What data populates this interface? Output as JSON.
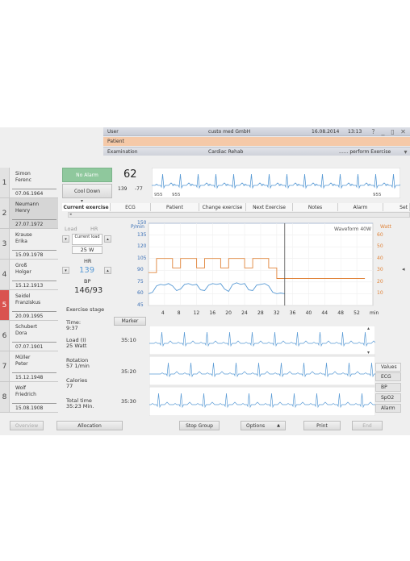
{
  "header": {
    "user_label": "User",
    "user_value": "custo med GmbH",
    "date": "16.08.2014",
    "time": "13:13",
    "patient_label": "Patient",
    "examination_label": "Examination",
    "examination_value": "Cardiac Rehab",
    "perform_label": "...... perform Exercise"
  },
  "patients": [
    {
      "num": "1",
      "first": "Simon",
      "last": "Ferenc",
      "dob": "07.06.1964"
    },
    {
      "num": "2",
      "first": "Neumann",
      "last": "Henry",
      "dob": "27.07.1972"
    },
    {
      "num": "3",
      "first": "Krause",
      "last": "Erika",
      "dob": "15.09.1978"
    },
    {
      "num": "4",
      "first": "Groß",
      "last": "Holger",
      "dob": "15.12.1913"
    },
    {
      "num": "5",
      "first": "Seidel",
      "last": "Franziskus",
      "dob": "20.09.1995"
    },
    {
      "num": "6",
      "first": "Schubert",
      "last": "Dora",
      "dob": "07.07.1901"
    },
    {
      "num": "7",
      "first": "Müller",
      "last": "Peter",
      "dob": "15.12.1948"
    },
    {
      "num": "8",
      "first": "Wolf",
      "last": "Friedrich",
      "dob": "15.08.1908"
    }
  ],
  "status": {
    "alarm_button": "No Alarm",
    "cooldown_button": "Cool Down",
    "hr_big": "62",
    "bp_small_1": "139",
    "bp_small_2": "-77",
    "strip_label_1": "955",
    "strip_label_2": "955",
    "strip_label_3": "955"
  },
  "tabs": [
    "Current exercise",
    "ECG",
    "Patient",
    "Change exercise",
    "Next Exercise",
    "Notes",
    "Alarm",
    "Set"
  ],
  "controls": {
    "load_tab": "Load",
    "hr_tab": "HR",
    "current_load_label": "Current load",
    "current_load_value": "25 W",
    "hr_label": "HR",
    "hr_value": "139",
    "bp_label": "BP",
    "bp_value": "146/93"
  },
  "stage": {
    "title": "Exercise stage",
    "time_label": "Time:",
    "time_value": "9:37",
    "load_label": "Load (I)",
    "load_value": "25 Watt",
    "rotation_label": "Rotation",
    "rotation_value": "57 1/min",
    "calories_label": "Calories",
    "calories_value": "77",
    "total_label": "Total time",
    "total_value": "35:23 Min."
  },
  "chart_data": {
    "type": "line",
    "left_axis_title": "P/min",
    "right_axis_title": "Watt",
    "waveform_label": "Waveform 40W",
    "left_ticks": [
      "150",
      "135",
      "120",
      "105",
      "90",
      "75",
      "60",
      "45"
    ],
    "right_ticks": [
      "60",
      "50",
      "40",
      "30",
      "20",
      "10"
    ],
    "x_ticks": [
      "4",
      "8",
      "12",
      "16",
      "20",
      "24",
      "28",
      "32",
      "36",
      "40",
      "44",
      "48",
      "52",
      "min"
    ],
    "ylim_left": [
      45,
      150
    ],
    "ylim_right": [
      0,
      70
    ],
    "xlim": [
      0,
      56
    ],
    "cursor_x": 34,
    "series": [
      {
        "axis": "right",
        "color": "#e0843a",
        "x": [
          0,
          2,
          2,
          6,
          6,
          8,
          8,
          12,
          12,
          14,
          14,
          18,
          18,
          20,
          20,
          24,
          24,
          26,
          26,
          30,
          30,
          32,
          32,
          54
        ],
        "y": [
          28,
          28,
          40,
          40,
          32,
          32,
          40,
          40,
          32,
          32,
          40,
          40,
          32,
          32,
          40,
          40,
          32,
          32,
          40,
          40,
          32,
          32,
          23,
          23
        ]
      },
      {
        "axis": "left",
        "color": "#5a9bd5",
        "x": [
          0,
          1,
          2,
          3,
          4,
          5,
          6,
          7,
          8,
          9,
          10,
          11,
          12,
          13,
          14,
          15,
          16,
          17,
          18,
          19,
          20,
          21,
          22,
          23,
          24,
          25,
          26,
          27,
          28,
          29,
          30,
          31,
          32,
          33,
          34
        ],
        "y": [
          60,
          62,
          70,
          72,
          71,
          73,
          70,
          64,
          66,
          72,
          73,
          71,
          72,
          65,
          64,
          71,
          73,
          72,
          73,
          66,
          63,
          72,
          74,
          72,
          73,
          65,
          64,
          71,
          72,
          73,
          70,
          62,
          60,
          61,
          60
        ]
      }
    ]
  },
  "ecg": {
    "marker_label": "Marker",
    "rows": [
      "35:10",
      "35:20",
      "35:30"
    ]
  },
  "side_panel": [
    "Values",
    "ECG",
    "BP",
    "SpO2",
    "Alarm"
  ],
  "bottom": {
    "overview": "Overview",
    "allocation": "Allocation",
    "stop_group": "Stop Group",
    "options": "Options",
    "print": "Print",
    "end": "End"
  },
  "colors": {
    "accent_green": "#8fc89d",
    "patient_bar": "#f5c9a8",
    "alert_red": "#d9534f",
    "hr_blue": "#5a9bd5",
    "load_orange": "#e0843a"
  }
}
